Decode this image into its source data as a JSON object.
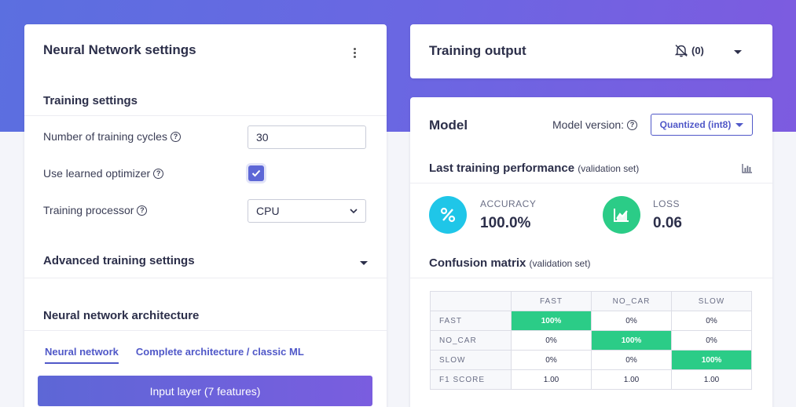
{
  "left_card": {
    "title": "Neural Network settings",
    "training_settings": {
      "heading": "Training settings",
      "cycles_label": "Number of training cycles",
      "cycles_value": "30",
      "optimizer_label": "Use learned optimizer",
      "optimizer_checked": true,
      "processor_label": "Training processor",
      "processor_value": "CPU"
    },
    "advanced_heading": "Advanced training settings",
    "architecture_heading": "Neural network architecture",
    "tabs": [
      {
        "label": "Neural network",
        "active": true
      },
      {
        "label": "Complete architecture / classic ML",
        "active": false
      }
    ],
    "input_layer_label": "Input layer (7 features)"
  },
  "output_card": {
    "title": "Training output",
    "notification_count": "(0)"
  },
  "model_card": {
    "title": "Model",
    "version_label": "Model version:",
    "version_value": "Quantized (int8)",
    "last_perf_heading": "Last training performance",
    "last_perf_note": "(validation set)",
    "accuracy_label": "ACCURACY",
    "accuracy_value": "100.0%",
    "loss_label": "LOSS",
    "loss_value": "0.06",
    "confusion_heading": "Confusion matrix",
    "confusion_note": "(validation set)",
    "confusion_matrix": {
      "columns": [
        "FAST",
        "NO_CAR",
        "SLOW"
      ],
      "rows": [
        {
          "label": "FAST",
          "cells": [
            "100%",
            "0%",
            "0%"
          ]
        },
        {
          "label": "NO_CAR",
          "cells": [
            "0%",
            "100%",
            "0%"
          ]
        },
        {
          "label": "SLOW",
          "cells": [
            "0%",
            "0%",
            "100%"
          ]
        },
        {
          "label": "F1 SCORE",
          "cells": [
            "1.00",
            "1.00",
            "1.00"
          ]
        }
      ]
    }
  },
  "colors": {
    "accent": "#5058c8",
    "accuracy_icon": "#1fc6e8",
    "loss_icon": "#2bcc87",
    "matrix_hit": "#2bcc87"
  },
  "icons": {
    "kebab": "kebab-menu-icon",
    "help": "question-circle-icon",
    "bell": "bell-off-icon",
    "chart": "bar-chart-icon",
    "percent": "percent-icon",
    "trend": "trend-chart-icon"
  }
}
